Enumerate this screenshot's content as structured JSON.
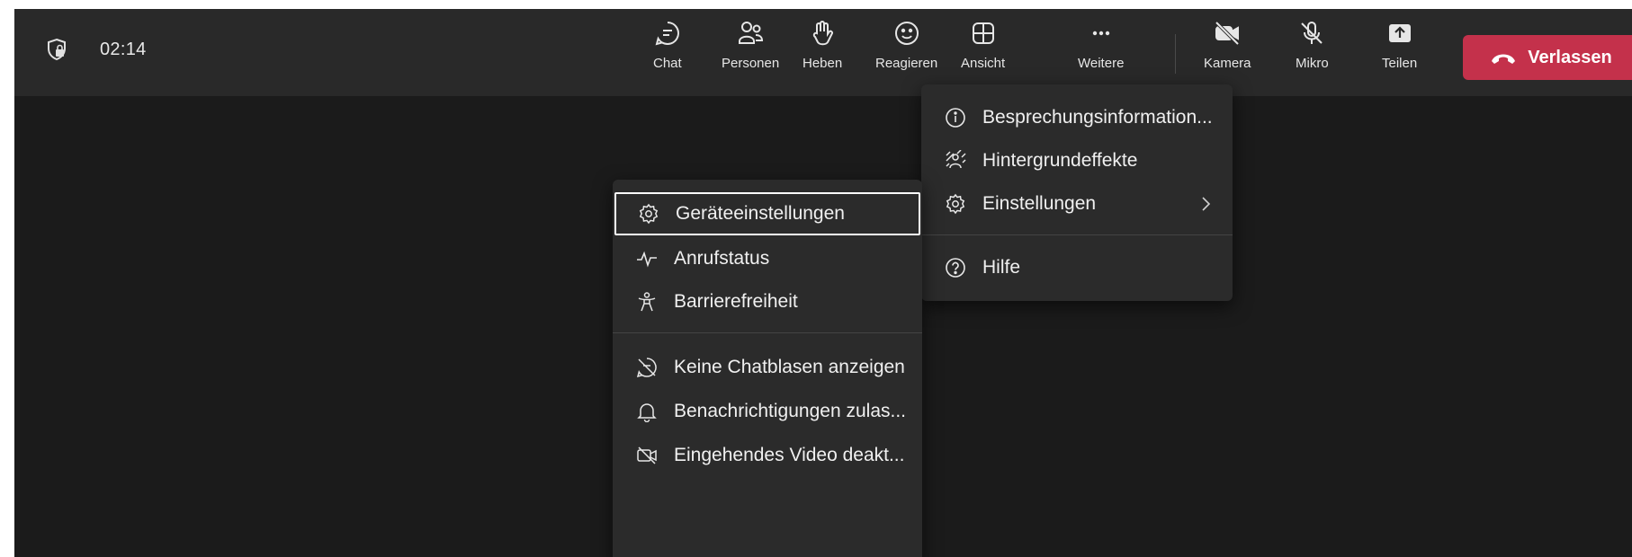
{
  "timer": "02:14",
  "toolbar": {
    "chat": "Chat",
    "people": "Personen",
    "raise": "Heben",
    "react": "Reagieren",
    "view": "Ansicht",
    "more": "Weitere",
    "camera": "Kamera",
    "mic": "Mikro",
    "share": "Teilen",
    "leave": "Verlassen"
  },
  "more_menu": {
    "items": [
      {
        "label": "Besprechungsinformation...",
        "icon": "info-icon"
      },
      {
        "label": "Hintergrundeffekte",
        "icon": "background-effects-icon"
      },
      {
        "label": "Einstellungen",
        "icon": "gear-icon"
      },
      {
        "label": "Hilfe",
        "icon": "help-icon"
      }
    ]
  },
  "settings_menu": {
    "items": [
      {
        "label": "Geräteeinstellungen",
        "icon": "gear-icon"
      },
      {
        "label": "Anrufstatus",
        "icon": "pulse-icon"
      },
      {
        "label": "Barrierefreiheit",
        "icon": "accessibility-icon"
      },
      {
        "label": "Keine Chatblasen anzeigen",
        "icon": "chat-off-icon"
      },
      {
        "label": "Benachrichtigungen zulas...",
        "icon": "bell-icon"
      },
      {
        "label": "Eingehendes Video deakt...",
        "icon": "video-off-icon"
      }
    ]
  },
  "colors": {
    "accent": "#7f85f5",
    "leave": "#c4314b",
    "topbar": "#292929",
    "stage": "#1b1b1b",
    "menu": "#2b2b2b"
  }
}
